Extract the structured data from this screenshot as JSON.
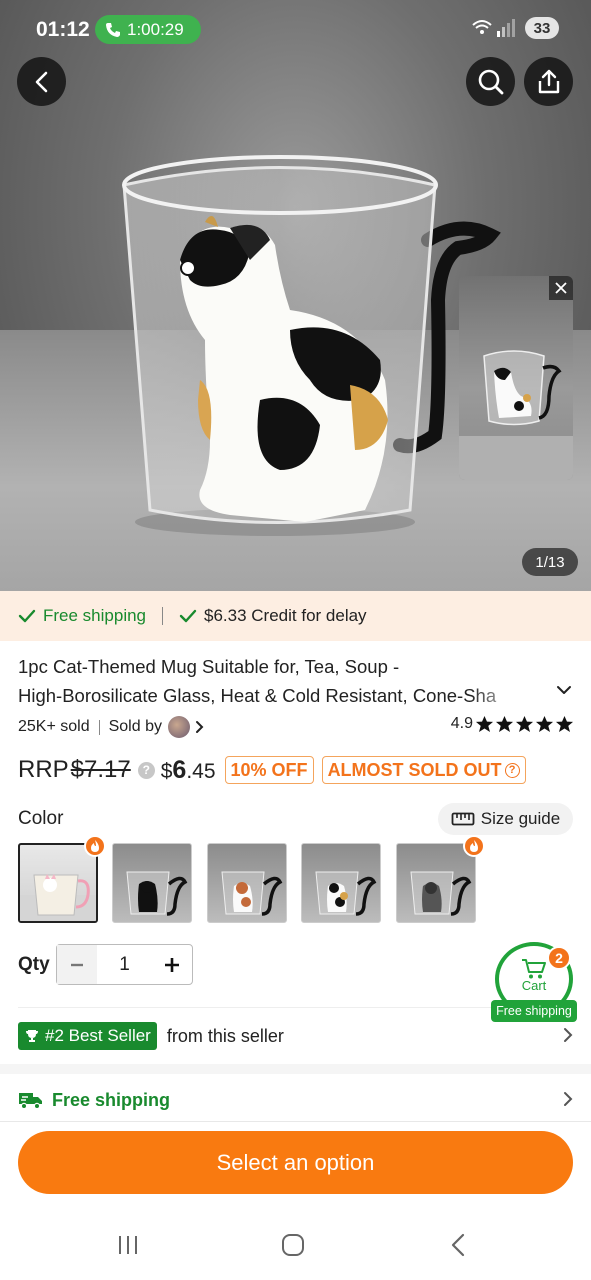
{
  "status_bar": {
    "time": "01:12",
    "call_duration": "1:00:29",
    "battery": "33"
  },
  "gallery": {
    "counter": "1/13"
  },
  "shipping_banner": {
    "free_shipping": "Free shipping",
    "credit": "$6.33 Credit for delay"
  },
  "product": {
    "title_line1": "1pc Cat-Themed Mug Suitable for, Tea, Soup -",
    "title_line2": "High-Borosilicate Glass, Heat & Cold Resistant, Cone-Sha",
    "sold": "25K+ sold",
    "sold_by": "Sold by",
    "rating": "4.9",
    "rrp_label": "RRP",
    "rrp_value": "$7.17",
    "price_currency": "$",
    "price_whole": "6",
    "price_fraction": ".45",
    "discount_tag": "10% OFF",
    "stock_tag": "ALMOST SOLD OUT"
  },
  "options": {
    "color_label": "Color",
    "size_guide": "Size guide",
    "qty_label": "Qty",
    "qty_value": "1"
  },
  "cart": {
    "label": "Cart",
    "count": "2",
    "free_shipping": "Free shipping"
  },
  "best_seller": {
    "badge": "#2 Best Seller",
    "suffix": "from this seller"
  },
  "free_shipping_row": {
    "label": "Free shipping"
  },
  "cta": {
    "label": "Select an option"
  },
  "colors": {
    "accent_orange": "#f97a10",
    "green": "#198a2e",
    "banner_bg": "#fdeee2"
  }
}
